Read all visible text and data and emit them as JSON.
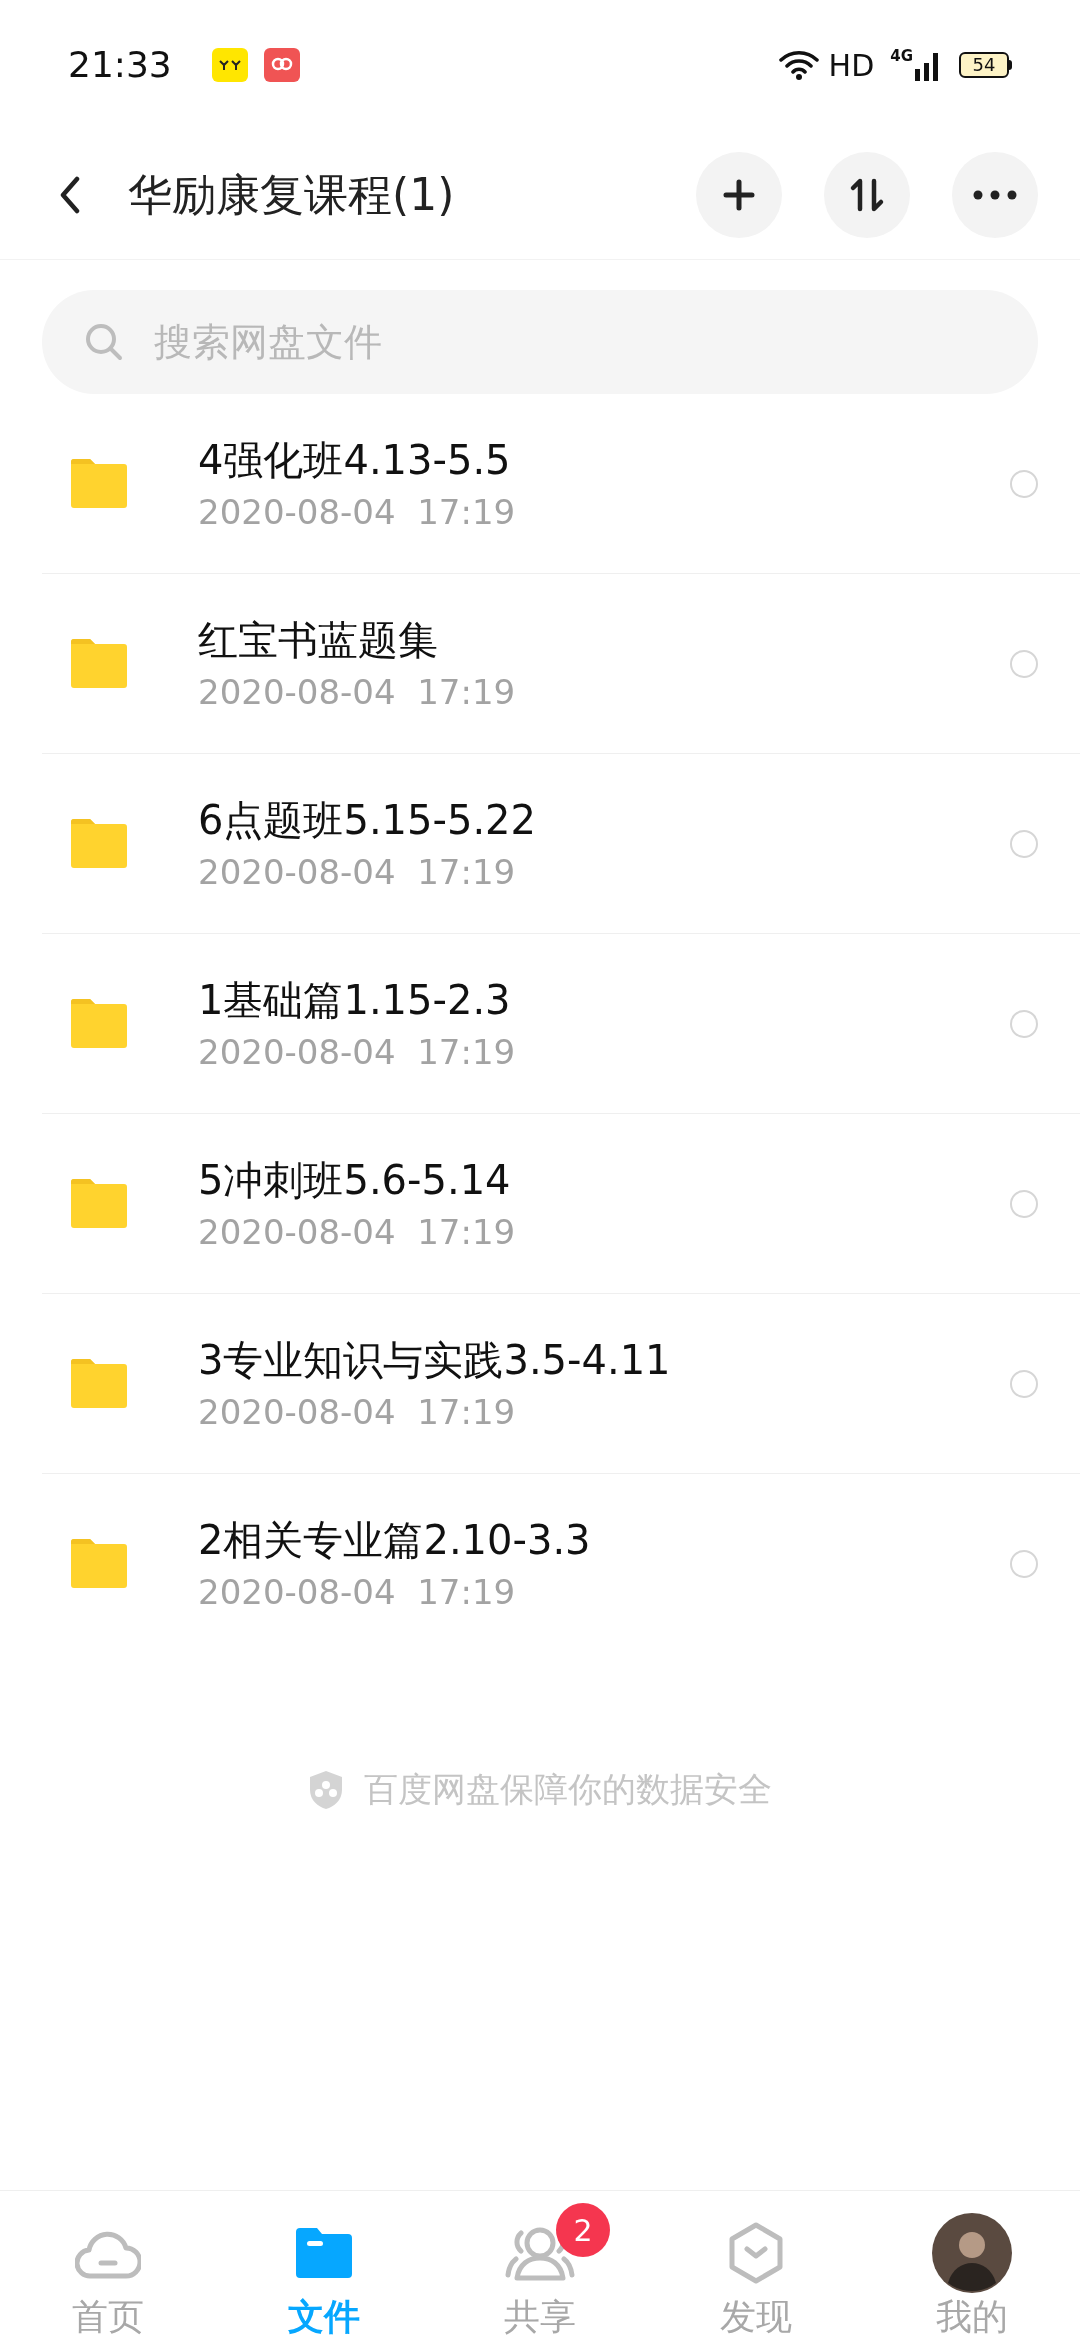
{
  "status_bar": {
    "time": "21:33",
    "network": "HD",
    "signal": "4G",
    "battery": "54"
  },
  "header": {
    "title": "华励康复课程(1)"
  },
  "search": {
    "placeholder": "搜索网盘文件"
  },
  "files": [
    {
      "name": "4强化班4.13-5.5",
      "date": "2020-08-04  17:19",
      "checked": false
    },
    {
      "name": "红宝书蓝题集",
      "date": "2020-08-04  17:19",
      "checked": false
    },
    {
      "name": "6点题班5.15-5.22",
      "date": "2020-08-04  17:19",
      "checked": false
    },
    {
      "name": "1基础篇1.15-2.3",
      "date": "2020-08-04  17:19",
      "checked": false
    },
    {
      "name": "5冲刺班5.6-5.14",
      "date": "2020-08-04  17:19",
      "checked": false
    },
    {
      "name": "3专业知识与实践3.5-4.11",
      "date": "2020-08-04  17:19",
      "checked": false
    },
    {
      "name": "2相关专业篇2.10-3.3",
      "date": "2020-08-04  17:19",
      "checked": false
    }
  ],
  "footer_note": "百度网盘保障你的数据安全",
  "bottom_nav": [
    {
      "kind": "home",
      "label": "首页",
      "selected": false
    },
    {
      "kind": "files",
      "label": "文件",
      "selected": true
    },
    {
      "kind": "share",
      "label": "共享",
      "selected": false,
      "badge": "2"
    },
    {
      "kind": "discover",
      "label": "发现",
      "selected": false
    },
    {
      "kind": "me",
      "label": "我的",
      "selected": false
    }
  ]
}
